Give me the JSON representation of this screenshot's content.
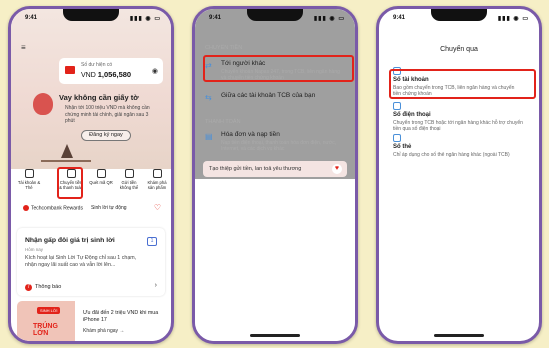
{
  "status": {
    "time": "9:41",
    "signal": "▮▮▮ ◉ ▭"
  },
  "phone1": {
    "account": {
      "label": "Số dư hiện có",
      "currency": "VND",
      "balance": "1,056,580"
    },
    "promo": {
      "title": "Vay không cần giấy tờ",
      "text": "Nhận tới 100 triệu VND mà không cần chứng minh tài chính, giải ngân sau 3 phút",
      "button": "Đăng ký ngay"
    },
    "quick_actions": [
      "Tài khoản & Thẻ",
      "Chuyển tiền & thanh toán",
      "Quét mã QR",
      "Gửi tiền không thể",
      "Khám phá sản phẩm"
    ],
    "rewards": {
      "left": "Techcombank Rewards",
      "right": "Sinh lời tự động"
    },
    "referral": {
      "title": "Nhận gấp đôi giá trị sinh lời",
      "subtitle": "Hôm nay",
      "text": "Kích hoạt lại Sinh Lời Tự Động chỉ sau 1 chạm, nhận ngay lãi suất cao và vẫn lời lên...",
      "notice": "Thông báo",
      "badge": "1"
    },
    "promo_card": {
      "tag": "SINH LỜI",
      "big": "TRÚNG LỚN",
      "title": "Ưu đãi đến 2 triệu VND khi mua iPhone 17",
      "link": "Khám phá ngay →"
    }
  },
  "phone2": {
    "section_transfer": "CHUYỂN TIỀN",
    "rows": [
      {
        "title": "Tới người khác",
        "sub": "Chuyển khoản Napas 247, trong TCB, liên ngân hàng và chuyển tiền chứng khoán"
      },
      {
        "title": "Giữa các tài khoản TCB của bạn",
        "sub": ""
      }
    ],
    "section_payment": "THANH TOÁN",
    "payment_row": {
      "title": "Hóa đơn và nạp tiền",
      "sub": "Nạp tiền điện thoại, thanh toán hóa đơn điện, nước, Internet, và các dịch vụ khác"
    },
    "gift": "Tạo thiệp gửi tiền, lan toả yêu thương"
  },
  "phone3": {
    "title": "Chuyển qua",
    "options": [
      {
        "title": "Số tài khoản",
        "sub": "Bao gồm chuyển trong TCB, liên ngân hàng và chuyển tiền chứng khoán"
      },
      {
        "title": "Số điện thoại",
        "sub": "Chuyển trong TCB hoặc tới ngân hàng khác hỗ trợ chuyển tiền qua số điện thoại"
      },
      {
        "title": "Số thẻ",
        "sub": "Chỉ áp dụng cho số thẻ ngân hàng khác (ngoài TCB)"
      }
    ]
  },
  "colors": {
    "accent": "#e2231a",
    "frame": "#7a5aa8",
    "background": "#f6efc6"
  }
}
